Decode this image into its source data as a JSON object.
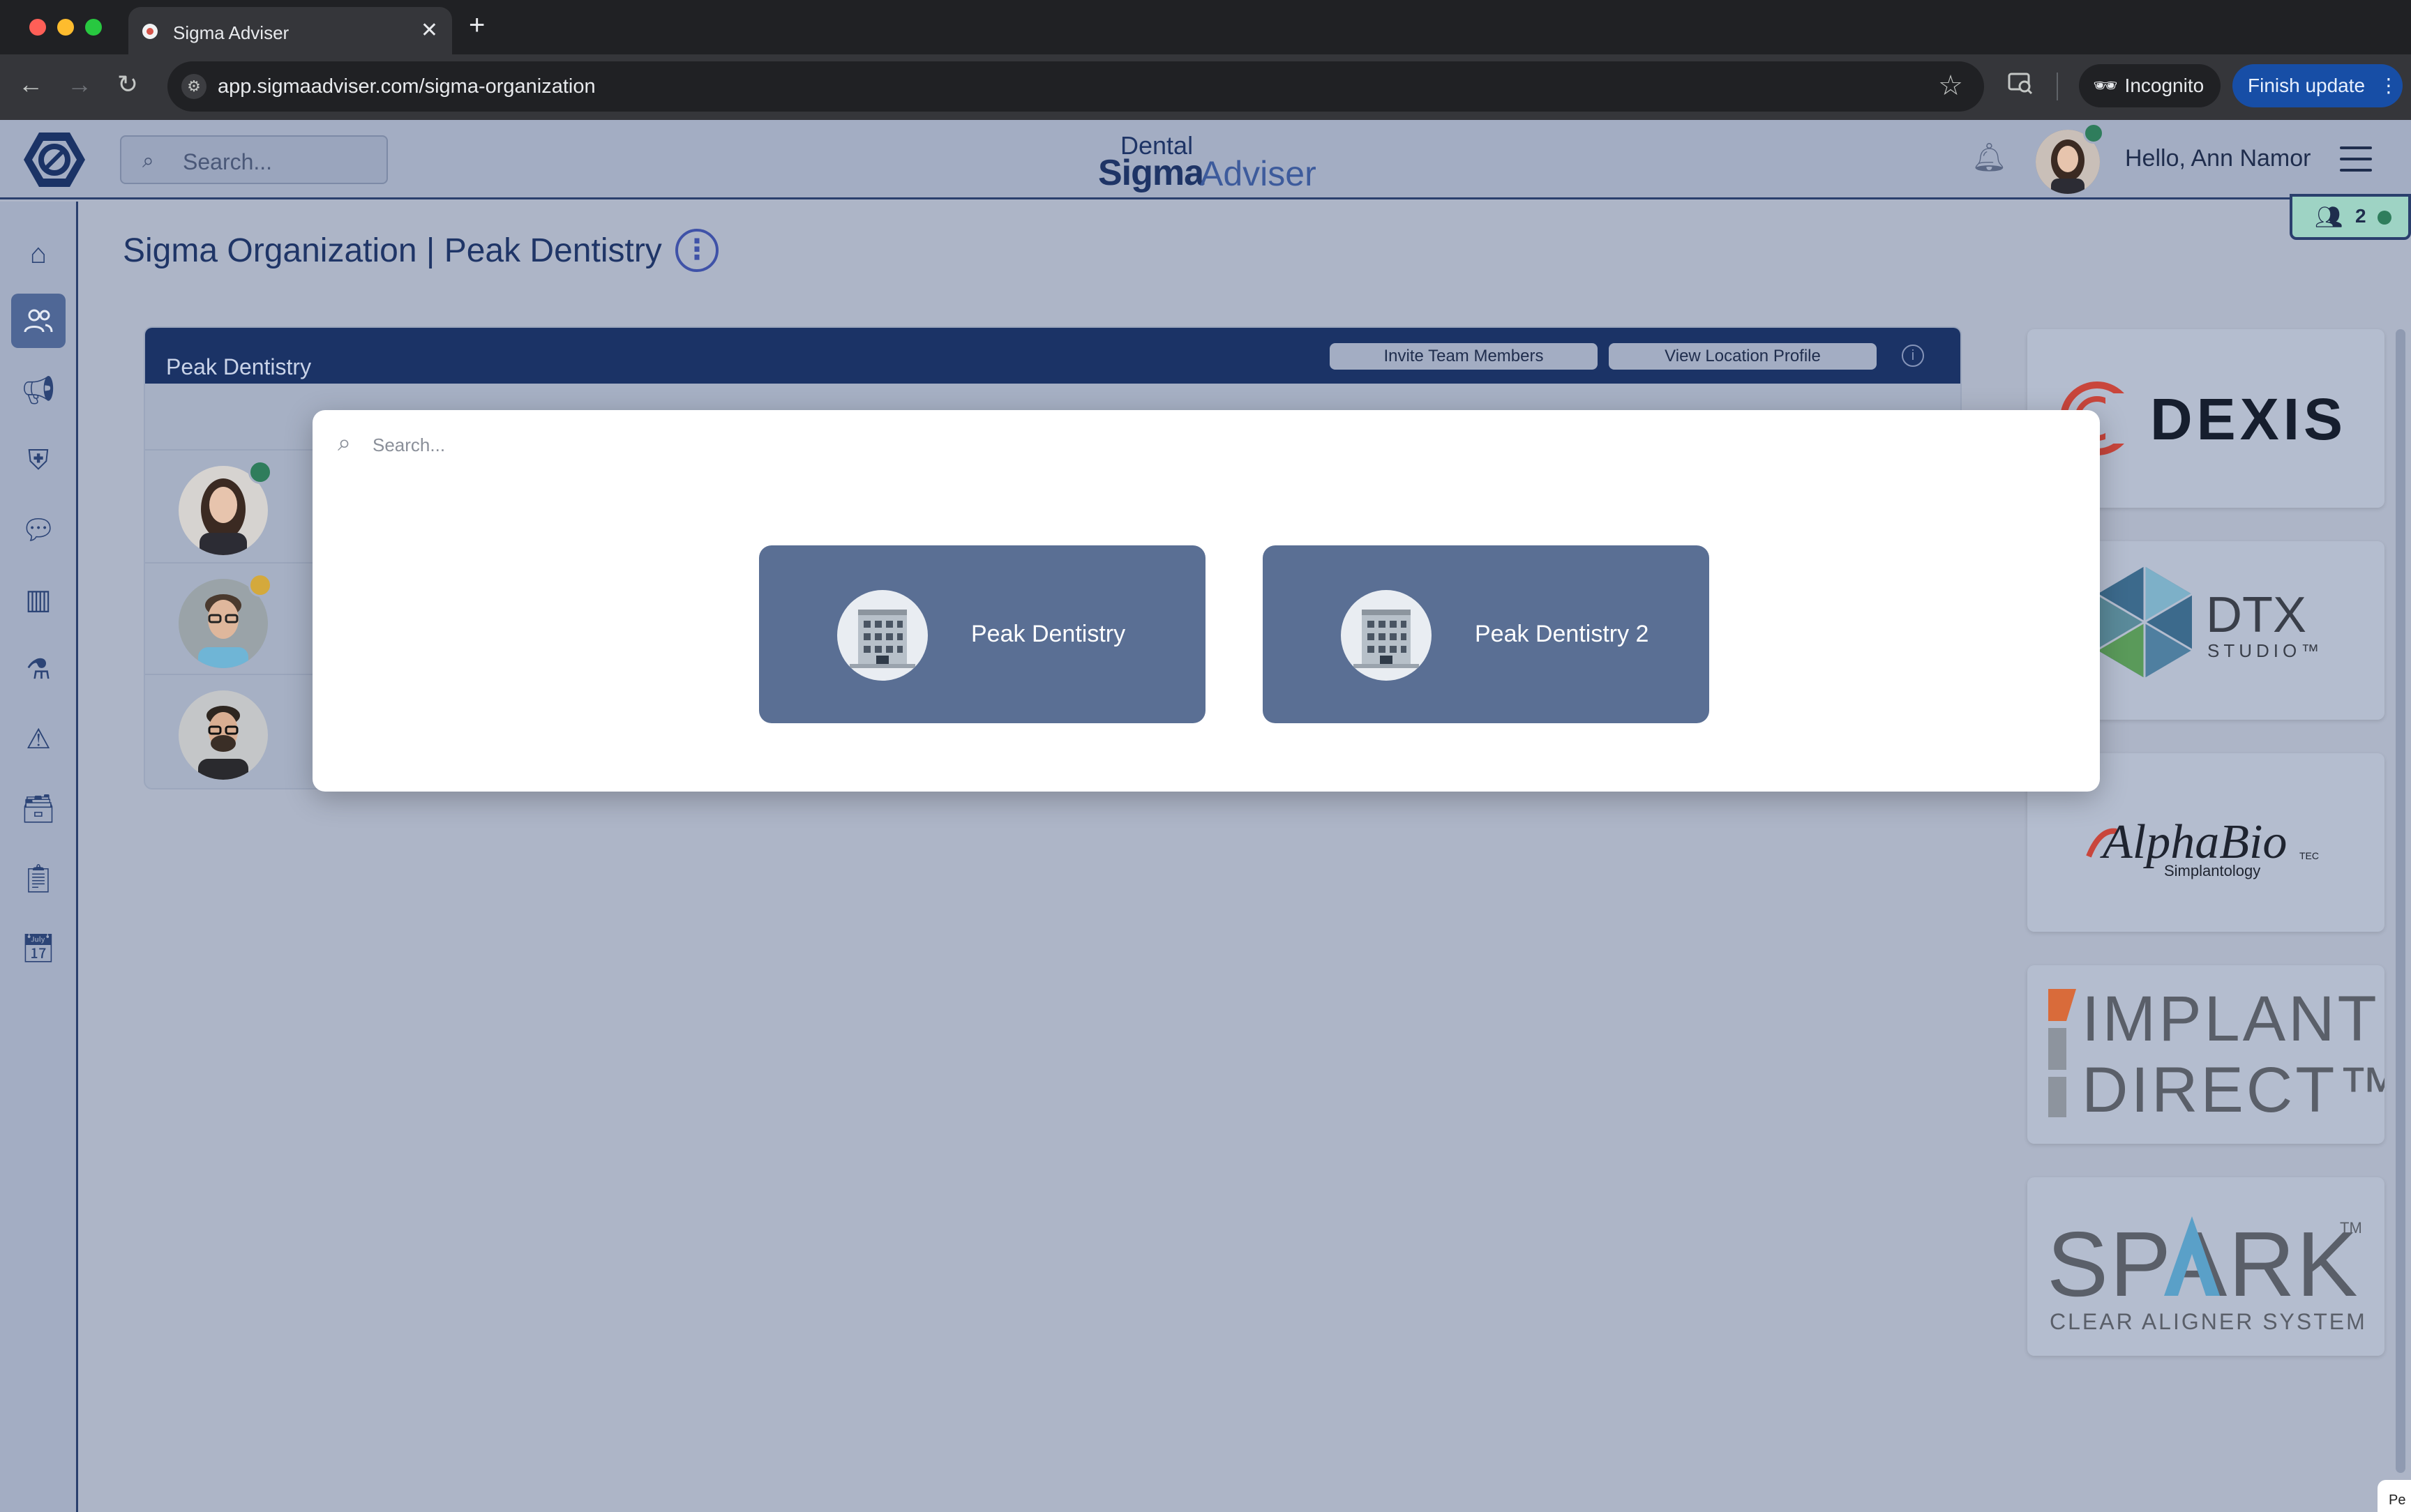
{
  "browser": {
    "tab_title": "Sigma Adviser",
    "tab_close": "✕",
    "new_tab": "+",
    "url": "app.sigmaadviser.com/sigma-organization",
    "incognito_label": "Incognito",
    "finish_update_label": "Finish update"
  },
  "header": {
    "search_placeholder": "Search...",
    "brand_top": "Dental",
    "brand_sigma": "Sigma",
    "brand_adviser": "Adviser",
    "greeting": "Hello, Ann Namor"
  },
  "sidebar": {
    "items": [
      {
        "icon": "home-icon"
      },
      {
        "icon": "users-icon",
        "active": true
      },
      {
        "icon": "megaphone-icon"
      },
      {
        "icon": "shield-check-icon"
      },
      {
        "icon": "chat-icon"
      },
      {
        "icon": "columns-icon"
      },
      {
        "icon": "flask-icon"
      },
      {
        "icon": "alert-triangle-icon"
      },
      {
        "icon": "archive-icon"
      },
      {
        "icon": "clipboard-icon"
      },
      {
        "icon": "calendar-icon"
      }
    ]
  },
  "page": {
    "title": "Sigma Organization | Peak Dentistry",
    "online_count": "2"
  },
  "location_card": {
    "name": "Peak Dentistry",
    "invite_label": "Invite Team Members",
    "view_profile_label": "View Location Profile",
    "info_symbol": "i"
  },
  "members": [
    {
      "status_color": "#2f7d5c"
    },
    {
      "status_color": "#d4a93c"
    },
    {
      "status_color": null
    }
  ],
  "sponsors": [
    "DEXIS",
    "DTX STUDIO",
    "AlphaBio Simplantology",
    "IMPLANT DIRECT",
    "SPARK CLEAR ALIGNER SYSTEM"
  ],
  "sponsor_text": {
    "dexis": "DEXIS",
    "dtx_main": "DTX",
    "dtx_sub": "STUDIO™",
    "alphabio_main": "AlphaBio",
    "alphabio_tec": "TEC",
    "alphabio_sub": "Simplantology",
    "implant_1": "IMPLANT",
    "implant_2": "DIRECT™",
    "spark_main": "SPARK",
    "spark_tm": "TM",
    "spark_sub": "CLEAR ALIGNER SYSTEM"
  },
  "modal": {
    "search_placeholder": "Search...",
    "locations": [
      {
        "name": "Peak Dentistry"
      },
      {
        "name": "Peak Dentistry 2"
      }
    ]
  },
  "corner_tab_text": "Pe",
  "colors": {
    "accent_dark": "#1b3366",
    "tile": "#5a6f94",
    "online": "#2f7d5c",
    "away": "#d4a93c",
    "finish_update": "#174ea6"
  }
}
